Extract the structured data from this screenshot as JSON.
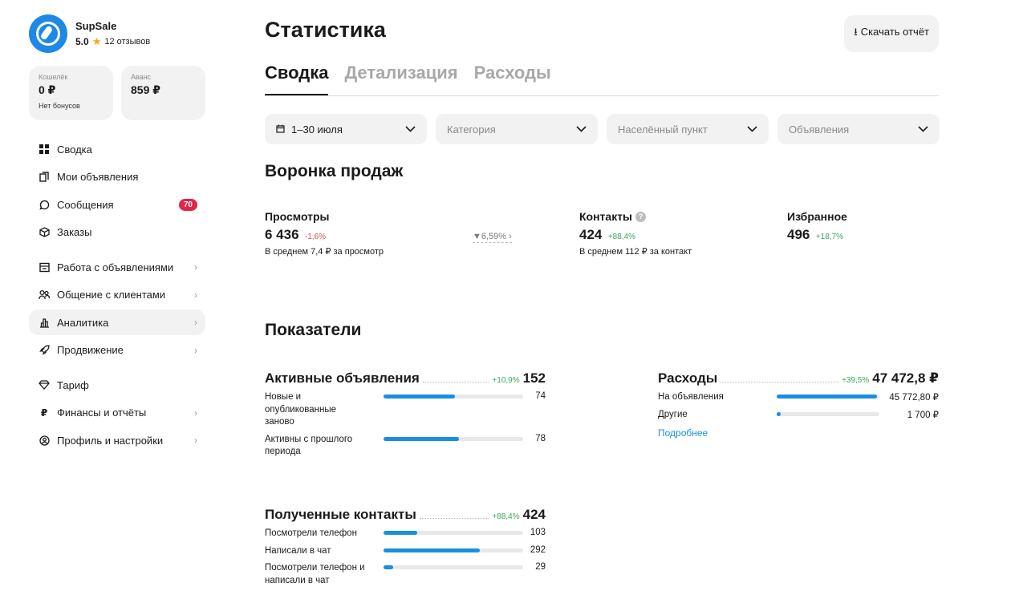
{
  "profile": {
    "name": "SupSale",
    "rating": "5.0",
    "reviews": "12 отзывов"
  },
  "wallets": [
    {
      "title": "Кошелёк",
      "value": "0 ₽",
      "note": "Нет бонусов"
    },
    {
      "title": "Аванс",
      "value": "859 ₽",
      "note": ""
    }
  ],
  "nav": {
    "summary": "Сводка",
    "my_ads": "Мои объявления",
    "messages": "Сообщения",
    "messages_badge": "70",
    "orders": "Заказы",
    "ads_work": "Работа с объявлениями",
    "clients": "Общение с клиентами",
    "analytics": "Аналитика",
    "promotion": "Продвижение",
    "tariff": "Тариф",
    "finance": "Финансы и отчёты",
    "settings": "Профиль и настройки"
  },
  "header": {
    "title": "Статистика",
    "download": "Скачать отчёт"
  },
  "tabs": [
    "Сводка",
    "Детализация",
    "Расходы"
  ],
  "filters": {
    "date": "1–30 июля",
    "category": "Категория",
    "city": "Населённый пункт",
    "ads": "Объявления"
  },
  "funnel": {
    "title": "Воронка продаж",
    "views": {
      "label": "Просмотры",
      "value": "6 436",
      "delta": "-1,6%",
      "sub": "В среднем 7,4 ₽ за просмотр"
    },
    "conversion": "6,59%",
    "contacts": {
      "label": "Контакты",
      "value": "424",
      "delta": "+88,4%",
      "sub": "В среднем 112 ₽ за контакт"
    },
    "favorites": {
      "label": "Избранное",
      "value": "496",
      "delta": "+18,7%"
    }
  },
  "indicators": {
    "title": "Показатели",
    "active": {
      "title": "Активные объявления",
      "delta": "+10,9%",
      "total": "152",
      "rows": [
        {
          "label": "Новые и опубликованные заново",
          "value": "74",
          "fill": 0.51
        },
        {
          "label": "Активны с прошлого периода",
          "value": "78",
          "fill": 0.54
        }
      ]
    },
    "expenses": {
      "title": "Расходы",
      "delta": "+39,5%",
      "total": "47 472,8 ₽",
      "rows": [
        {
          "label": "На объявления",
          "value": "45 772,80 ₽",
          "fill": 0.98
        },
        {
          "label": "Другие",
          "value": "1 700 ₽",
          "fill": 0.04
        }
      ],
      "link": "Подробнее"
    },
    "contacts": {
      "title": "Полученные контакты",
      "delta": "+88,4%",
      "total": "424",
      "rows": [
        {
          "label": "Посмотрели телефон",
          "value": "103",
          "fill": 0.24
        },
        {
          "label": "Написали в чат",
          "value": "292",
          "fill": 0.69
        },
        {
          "label": "Посмотрели телефон и написали в чат",
          "value": "29",
          "fill": 0.07
        }
      ]
    }
  }
}
